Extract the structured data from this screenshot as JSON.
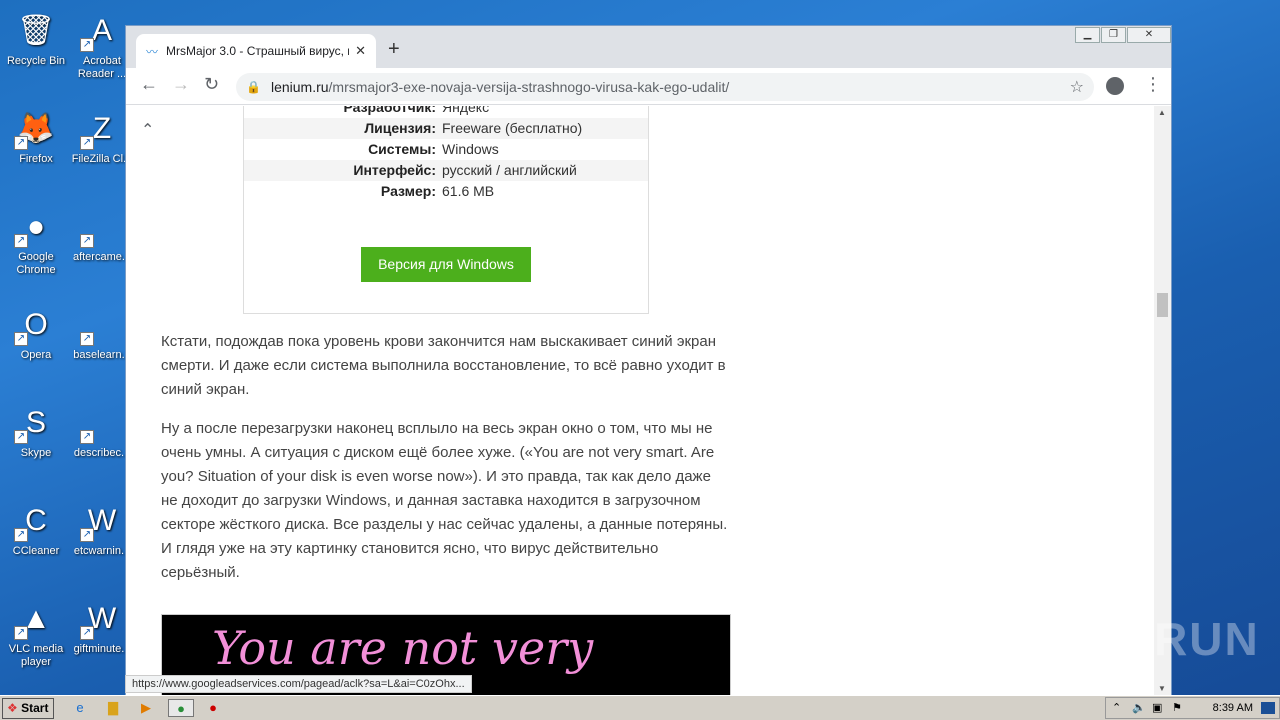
{
  "desktop": {
    "icons": [
      {
        "label": "Recycle Bin",
        "glyph": "🗑"
      },
      {
        "label": "Acrobat Reader ...",
        "glyph": "A"
      },
      {
        "label": "Firefox",
        "glyph": "🦊"
      },
      {
        "label": "FileZilla Cl...",
        "glyph": "Z"
      },
      {
        "label": "Google Chrome",
        "glyph": "●"
      },
      {
        "label": "aftercame...",
        "glyph": ""
      },
      {
        "label": "Opera",
        "glyph": "O"
      },
      {
        "label": "baselearn...",
        "glyph": ""
      },
      {
        "label": "Skype",
        "glyph": "S"
      },
      {
        "label": "describec...",
        "glyph": ""
      },
      {
        "label": "CCleaner",
        "glyph": "C"
      },
      {
        "label": "etcwarnin...",
        "glyph": "W"
      },
      {
        "label": "VLC media player",
        "glyph": "▲"
      },
      {
        "label": "giftminute...",
        "glyph": "W"
      }
    ]
  },
  "browser": {
    "tab_title": "MrsMajor 3.0 - Страшный вирус, н",
    "tab_icon": "chart-icon",
    "url_host": "lenium.ru",
    "url_path": "/mrsmajor3-exe-novaja-versija-strashnogo-virusa-kak-ego-udalit/"
  },
  "page": {
    "info_rows": [
      {
        "key": "Разработчик:",
        "value": "Яндекс"
      },
      {
        "key": "Лицензия:",
        "value": "Freeware (бесплатно)"
      },
      {
        "key": "Системы:",
        "value": "Windows"
      },
      {
        "key": "Интерфейс:",
        "value": "русский / английский"
      },
      {
        "key": "Размер:",
        "value": "61.6 MB"
      }
    ],
    "download_button": "Версия для Windows",
    "para1": "Кстати, подождав пока уровень крови закончится нам выскакивает синий экран смерти. И даже если система выполнила восстановление, то всё равно уходит в синий экран.",
    "para2": "Ну а после перезагрузки наконец всплыло на весь экран окно о том, что мы не очень умны. А ситуация с диском ещё более хуже. («You are not very smart. Are you? Situation of your disk is even worse now»). И это правда, так как дело даже не доходит до загрузки Windows, и данная заставка находится в загрузочном секторе жёсткого диска. Все разделы у нас сейчас удалены, а данные потеряны. И глядя уже на эту картинку становится ясно, что вирус действительно серьёзный.",
    "image_text": "You are not very"
  },
  "status_url": "https://www.googleadservices.com/pagead/aclk?sa=L&ai=C0zOhx...",
  "watermark": "ANY RUN",
  "taskbar": {
    "start_label": "Start",
    "clock": "8:39 AM"
  }
}
